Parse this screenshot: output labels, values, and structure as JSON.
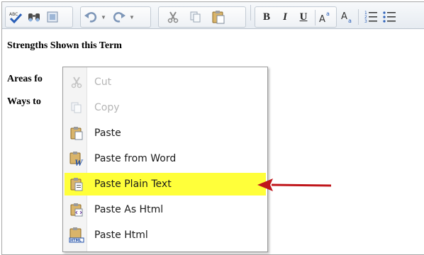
{
  "toolbar": {
    "buttons": [
      "spellcheck",
      "find",
      "select-all",
      "undo",
      "redo",
      "cut",
      "copy",
      "paste",
      "bold",
      "italic",
      "underline",
      "superscript",
      "subscript",
      "ordered-list",
      "unordered-list"
    ],
    "bold_label": "B",
    "italic_label": "I",
    "underline_label": "U"
  },
  "content": {
    "line1": "Strengths Shown this Term",
    "line2": "Areas fo",
    "line3": "Ways to"
  },
  "context_menu": {
    "items": [
      {
        "label": "Cut",
        "icon": "cut-icon",
        "disabled": true
      },
      {
        "label": "Copy",
        "icon": "copy-icon",
        "disabled": true
      },
      {
        "label": "Paste",
        "icon": "paste-icon",
        "disabled": false
      },
      {
        "label": "Paste from Word",
        "icon": "paste-from-word-icon",
        "disabled": false
      },
      {
        "label": "Paste Plain Text",
        "icon": "paste-plain-text-icon",
        "disabled": false,
        "highlighted": true
      },
      {
        "label": "Paste As Html",
        "icon": "paste-as-html-icon",
        "disabled": false
      },
      {
        "label": "Paste Html",
        "icon": "paste-html-icon",
        "disabled": false
      }
    ],
    "highlight_color": "#ffff3a"
  },
  "annotation": {
    "arrow_color": "#c0161b"
  }
}
